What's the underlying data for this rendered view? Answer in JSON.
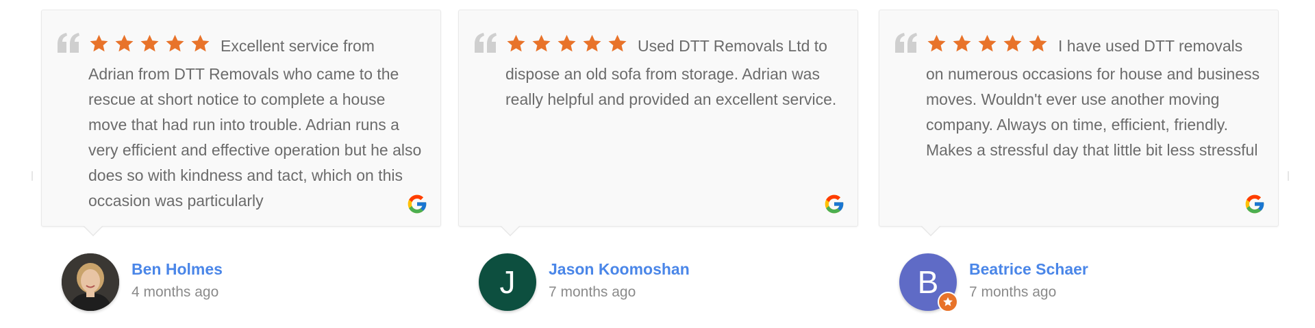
{
  "colors": {
    "star": "#e8732a",
    "name_link": "#4a86e8",
    "avatar_jason": "#0d4f3f",
    "avatar_beatrice": "#5f6bc6"
  },
  "reviews": [
    {
      "rating": 5,
      "text": "Excellent service from Adrian from DTT Removals who came to the rescue at short notice to complete a house move that had run into trouble. Adrian runs a very efficient and effective operation but he also does so with kindness and tact, which on this occasion was particularly",
      "source_icon": "google-icon",
      "author": "Ben Holmes",
      "time": "4 months ago",
      "avatar": "photo"
    },
    {
      "rating": 5,
      "text": "Used DTT Removals Ltd to dispose an old sofa from storage. Adrian was really helpful and provided an excellent service.",
      "source_icon": "google-icon",
      "author": "Jason Koomoshan",
      "time": "7 months ago",
      "avatar_letter": "J"
    },
    {
      "rating": 5,
      "text": "I have used DTT removals on numerous occasions for house and business moves. Wouldn't ever use another moving company. Always on time, efficient, friendly. Makes a stressful day that little bit less stressful",
      "source_icon": "google-icon",
      "author": "Beatrice Schaer",
      "time": "7 months ago",
      "avatar_letter": "B",
      "avatar_badge": "star-badge-icon"
    }
  ]
}
